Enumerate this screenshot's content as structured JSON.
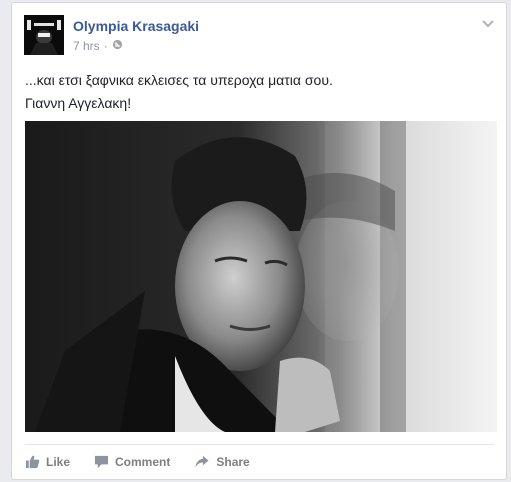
{
  "post": {
    "author": "Olympia Krasagaki",
    "time": "7 hrs",
    "separator": "·",
    "line1": "...και ετσι ξαφνικα εκλεισες τα υπεροχα ματια σου.",
    "line2": "Γιαννη Αγγελακη!"
  },
  "actions": {
    "like": "Like",
    "comment": "Comment",
    "share": "Share"
  },
  "icons": {
    "privacy": "globe-icon",
    "menu": "chevron-down-icon",
    "like": "thumbs-up-icon",
    "comment": "speech-bubble-icon",
    "share": "share-arrow-icon"
  },
  "colors": {
    "author": "#3b5998",
    "meta": "#90949c",
    "action": "#7f7f7f"
  }
}
